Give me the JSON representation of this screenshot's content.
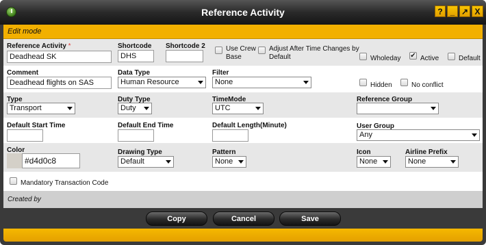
{
  "window": {
    "title": "Reference Activity"
  },
  "titlebar_buttons": {
    "help": "?",
    "minimize": "_",
    "maximize": "↗",
    "close": "X"
  },
  "mode": "Edit mode",
  "fields": {
    "reference_activity": {
      "label": "Reference Activity",
      "required_mark": "*",
      "value": "Deadhead SK"
    },
    "shortcode": {
      "label": "Shortcode",
      "value": "DHS"
    },
    "shortcode2": {
      "label": "Shortcode 2",
      "value": ""
    },
    "use_crew_base": {
      "label": "Use Crew Base",
      "checked": false
    },
    "adjust_after": {
      "label": "Adjust After Time Changes by Default",
      "checked": false
    },
    "wholeday": {
      "label": "Wholeday",
      "checked": false
    },
    "active": {
      "label": "Active",
      "checked": true
    },
    "default": {
      "label": "Default",
      "checked": false
    },
    "comment": {
      "label": "Comment",
      "value": "Deadhead flights on SAS"
    },
    "data_type": {
      "label": "Data Type",
      "value": "Human Resource"
    },
    "filter": {
      "label": "Filter",
      "value": "None"
    },
    "hidden": {
      "label": "Hidden",
      "checked": false
    },
    "no_conflict": {
      "label": "No conflict",
      "checked": false
    },
    "type": {
      "label": "Type",
      "value": "Transport"
    },
    "duty_type": {
      "label": "Duty Type",
      "value": "Duty"
    },
    "time_mode": {
      "label": "TimeMode",
      "value": "UTC"
    },
    "reference_group": {
      "label": "Reference Group",
      "value": ""
    },
    "default_start_time": {
      "label": "Default Start Time",
      "value": ""
    },
    "default_end_time": {
      "label": "Default End Time",
      "value": ""
    },
    "default_length": {
      "label": "Default Length(Minute)",
      "value": ""
    },
    "user_group": {
      "label": "User Group",
      "value": "Any"
    },
    "color": {
      "label": "Color",
      "value": "#d4d0c8"
    },
    "drawing_type": {
      "label": "Drawing Type",
      "value": "Default"
    },
    "pattern": {
      "label": "Pattern",
      "value": "None"
    },
    "icon": {
      "label": "Icon",
      "value": "None"
    },
    "airline_prefix": {
      "label": "Airline Prefix",
      "value": "None"
    },
    "mandatory_tx": {
      "label": "Mandatory Transaction Code",
      "checked": false
    }
  },
  "created_by": "Created by",
  "buttons": {
    "copy": "Copy",
    "cancel": "Cancel",
    "save": "Save"
  },
  "colors": {
    "accent": "#f2b000",
    "chrome": "#3a3a3a",
    "row_gray": "#e7e7e7",
    "swatch": "#d4d0c8"
  }
}
